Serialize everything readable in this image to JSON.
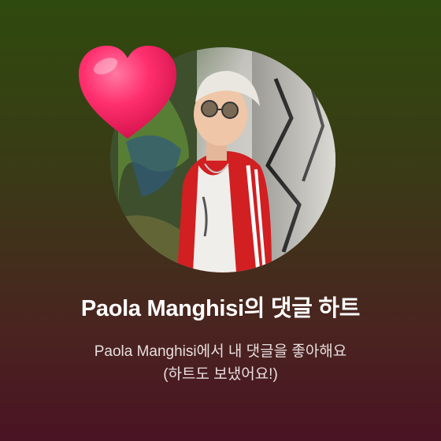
{
  "notification": {
    "title": "Paola Manghisi의 댓글 하트",
    "message_line1": "Paola Manghisi에서 내 댓글을 좋아해요",
    "message_line2": "(하트도 보냈어요!)"
  },
  "colors": {
    "background_top": "#2f4a0e",
    "background_bottom": "#4a1323",
    "heart": "#ff2a6d",
    "title_text": "#ffffff",
    "message_text": "#e7dede"
  },
  "icons": {
    "reaction": "heart-icon"
  }
}
